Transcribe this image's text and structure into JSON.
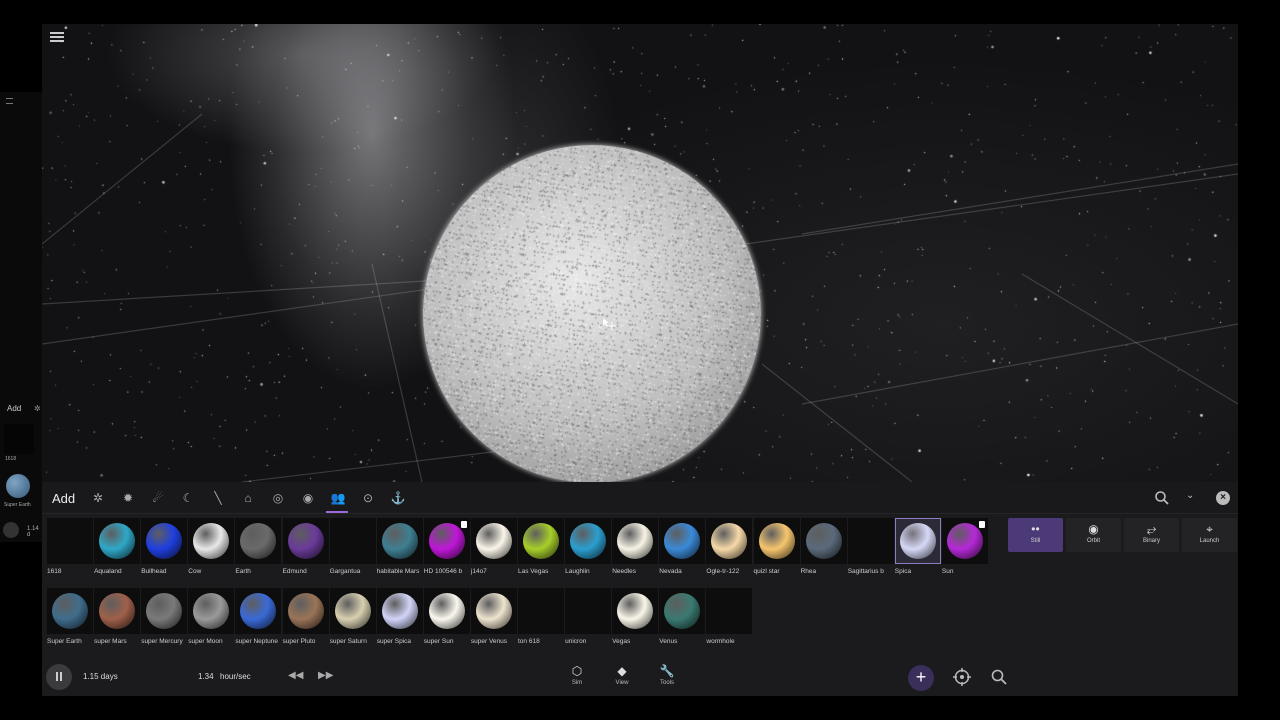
{
  "panel": {
    "title": "Add"
  },
  "categories": [
    {
      "icon": "galaxy-icon"
    },
    {
      "icon": "star-icon"
    },
    {
      "icon": "comet-icon"
    },
    {
      "icon": "moon-icon"
    },
    {
      "icon": "meteor-icon"
    },
    {
      "icon": "ship-icon"
    },
    {
      "icon": "spiral-icon"
    },
    {
      "icon": "eye-icon"
    },
    {
      "icon": "people-icon",
      "active": true
    },
    {
      "icon": "blackhole-icon"
    },
    {
      "icon": "anchor-icon"
    }
  ],
  "objects_row1": [
    {
      "label": "1618",
      "color": ""
    },
    {
      "label": "Aqualand",
      "color": "#2fa8c8"
    },
    {
      "label": "Bullhead",
      "color": "#1f3fe0"
    },
    {
      "label": "Cow",
      "color": "#e8e8e8"
    },
    {
      "label": "Earth",
      "color": "#6a6a6a"
    },
    {
      "label": "Edmund",
      "color": "#6a3a9a"
    },
    {
      "label": "Gargantua",
      "color": ""
    },
    {
      "label": "habitable Mars",
      "color": "#3e7f92"
    },
    {
      "label": "HD 100546 b",
      "color": "#c016d8",
      "badge": true
    },
    {
      "label": "j14o7",
      "color": "#fbf6ea"
    },
    {
      "label": "Las Vegas",
      "color": "#a7cf2a"
    },
    {
      "label": "Laughlin",
      "color": "#2b9fd0"
    },
    {
      "label": "Needles",
      "color": "#f7f3e5"
    },
    {
      "label": "Nevada",
      "color": "#3a8ad8"
    },
    {
      "label": "Ogle-tr-122",
      "color": "#f6d9a8"
    },
    {
      "label": "quizl star",
      "color": "#f6c66e"
    },
    {
      "label": "Rhea",
      "color": "#5a6a7a"
    },
    {
      "label": "Sagittarius b",
      "color": ""
    },
    {
      "label": "Spica",
      "color": "#d6d8f6",
      "selected": true
    },
    {
      "label": "Sun",
      "color": "#b628d8",
      "badge": true
    }
  ],
  "objects_row2": [
    {
      "label": "Super Earth",
      "color": "#3f6d8c"
    },
    {
      "label": "super Mars",
      "color": "#a0604a"
    },
    {
      "label": "super Mercury",
      "color": "#7a7a7a"
    },
    {
      "label": "super Moon",
      "color": "#9a9a9a"
    },
    {
      "label": "super Neptune",
      "color": "#3a6ad8"
    },
    {
      "label": "super Pluto",
      "color": "#9a7458"
    },
    {
      "label": "super Saturn",
      "color": "#d8d0b0"
    },
    {
      "label": "super Spica",
      "color": "#d2d4f8"
    },
    {
      "label": "super Sun",
      "color": "#fbf8ef"
    },
    {
      "label": "super Venus",
      "color": "#eee4cf"
    },
    {
      "label": "ton 618",
      "color": ""
    },
    {
      "label": "unicron",
      "color": ""
    },
    {
      "label": "Vegas",
      "color": "#faf7ea"
    },
    {
      "label": "Venus",
      "color": "#3a7a70"
    },
    {
      "label": "wormhole",
      "color": ""
    }
  ],
  "modes": [
    {
      "label": "Still",
      "icon": "still-icon",
      "glyph": "••",
      "active": true
    },
    {
      "label": "Orbit",
      "icon": "orbit-icon",
      "glyph": "◉"
    },
    {
      "label": "Binary",
      "icon": "binary-icon",
      "glyph": "⥂"
    },
    {
      "label": "Launch",
      "icon": "launch-icon",
      "glyph": "⌖"
    }
  ],
  "bottom": {
    "time": "1.15 days",
    "rate_value": "1.34",
    "rate_unit": "hour/sec",
    "nav": [
      {
        "label": "Sim",
        "icon": "cube-icon",
        "glyph": "⬡"
      },
      {
        "label": "View",
        "icon": "layers-icon",
        "glyph": "◆"
      },
      {
        "label": "Tools",
        "icon": "wrench-icon",
        "glyph": "🔧"
      }
    ]
  },
  "ghost": {
    "add": "Add",
    "label1": "1618",
    "label2": "Super Earth",
    "value": "1.14 d"
  },
  "colors": {
    "accent": "#9a6bd6",
    "panel": "#1b1b1d",
    "active_mode": "#4b3a77"
  }
}
